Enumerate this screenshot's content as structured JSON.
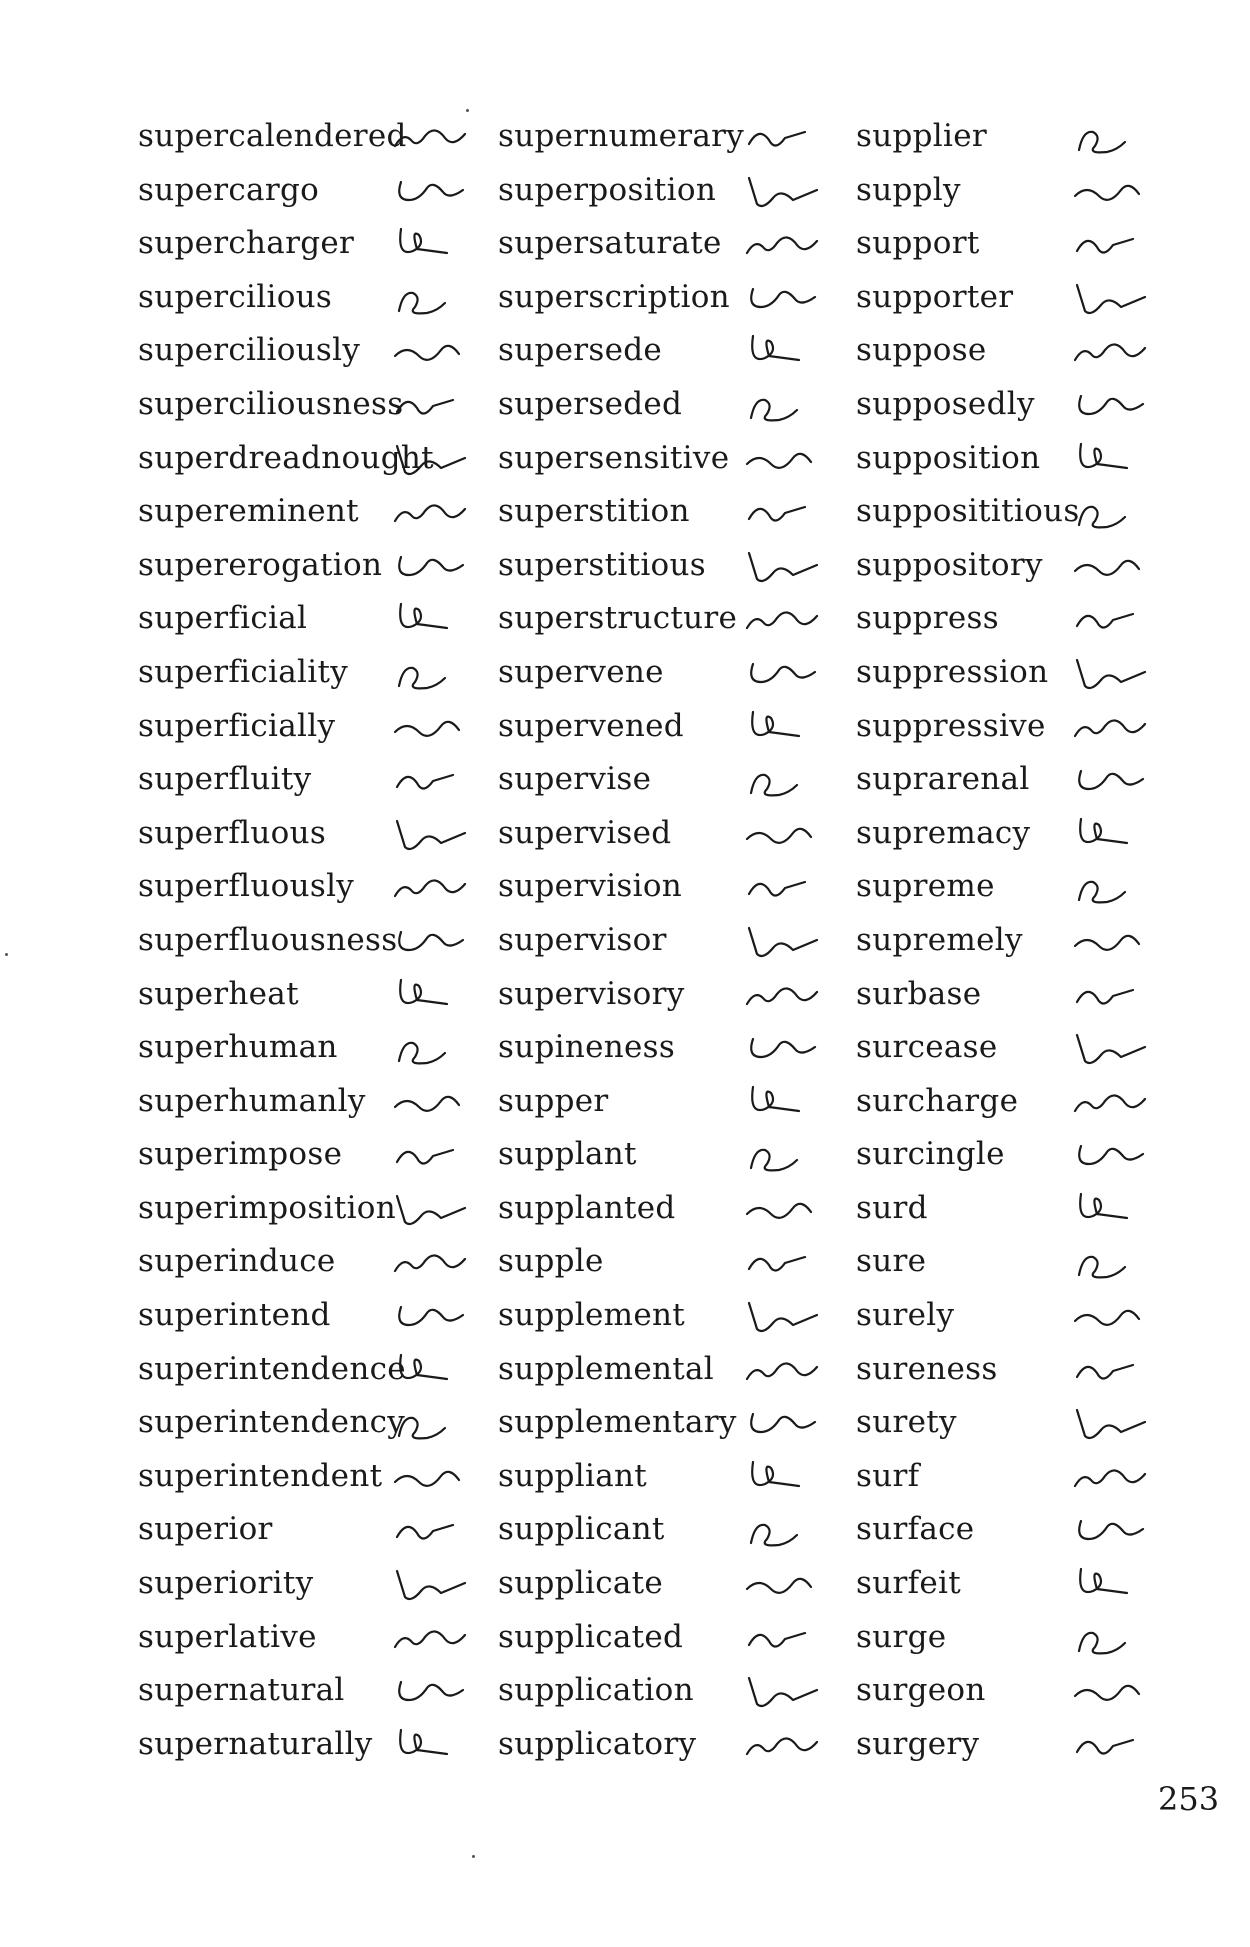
{
  "columns": [
    {
      "entries": [
        "supercalendered",
        "supercargo",
        "supercharger",
        "supercilious",
        "superciliously",
        "superciliousness",
        "superdreadnought",
        "supereminent",
        "supererogation",
        "superficial",
        "superficiality",
        "superficially",
        "superfluity",
        "superfluous",
        "superfluously",
        "superfluousness",
        "superheat",
        "superhuman",
        "superhumanly",
        "superimpose",
        "superimposition",
        "superinduce",
        "superintend",
        "superintendence",
        "superintendency",
        "superintendent",
        "superior",
        "superiority",
        "superlative",
        "supernatural",
        "supernaturally"
      ]
    },
    {
      "entries": [
        "supernumerary",
        "superposition",
        "supersaturate",
        "superscription",
        "supersede",
        "superseded",
        "supersensitive",
        "superstition",
        "superstitious",
        "superstructure",
        "supervene",
        "supervened",
        "supervise",
        "supervised",
        "supervision",
        "supervisor",
        "supervisory",
        "supineness",
        "supper",
        "supplant",
        "supplanted",
        "supple",
        "supplement",
        "supplemental",
        "supplementary",
        "suppliant",
        "supplicant",
        "supplicate",
        "supplicated",
        "supplication",
        "supplicatory"
      ]
    },
    {
      "entries": [
        "supplier",
        "supply",
        "support",
        "supporter",
        "suppose",
        "supposedly",
        "supposition",
        "supposititious",
        "suppository",
        "suppress",
        "suppression",
        "suppressive",
        "suprarenal",
        "supremacy",
        "supreme",
        "supremely",
        "surbase",
        "surcease",
        "surcharge",
        "surcingle",
        "surd",
        "sure",
        "surely",
        "sureness",
        "surety",
        "surf",
        "surface",
        "surfeit",
        "surge",
        "surgeon",
        "surgery"
      ]
    }
  ],
  "page_number": "253",
  "ink_color": "#1a1a1a"
}
